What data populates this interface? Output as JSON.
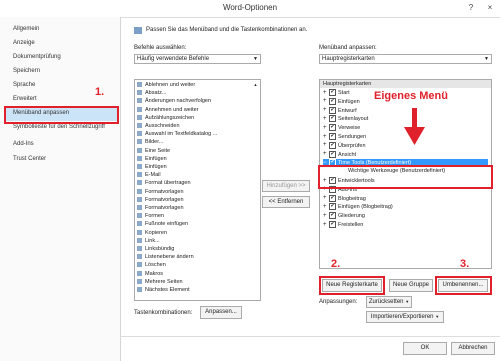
{
  "window": {
    "title": "Word-Optionen",
    "help": "?",
    "close": "×"
  },
  "sidebar": {
    "items": [
      "Allgemein",
      "Anzeige",
      "Dokumentprüfung",
      "Speichern",
      "Sprache",
      "Erweitert",
      "Menüband anpassen",
      "Symbolleiste für den Schnellzugriff",
      "Add-Ins",
      "Trust Center"
    ]
  },
  "header": {
    "text": "Passen Sie das Menüband und die Tastenkombinationen an."
  },
  "left_panel": {
    "label": "Befehle auswählen:",
    "select_value": "Häufig verwendete Befehle",
    "items": [
      "Ablehnen und weiter",
      "Absatz...",
      "Änderungen nachverfolgen",
      "Annehmen und weiter",
      "Aufzählungszeichen",
      "Ausschneiden",
      "Auswahl im Textfeldkatalog ...",
      "Bilder...",
      "Eine Seite",
      "Einfügen",
      "Einfügen",
      "E-Mail",
      "Format übertragen",
      "Formatvorlagen",
      "Formatvorlagen",
      "Formatvorlagen",
      "Formen",
      "Fußnote einfügen",
      "Kopieren",
      "Link...",
      "Linksbündig",
      "Listenebene ändern",
      "Löschen",
      "Makros",
      "Mehrere Seiten",
      "Nächstes Element"
    ]
  },
  "middle": {
    "add": "Hinzufügen >>",
    "remove": "<< Entfernen"
  },
  "right_panel": {
    "label": "Menüband anpassen:",
    "select_value": "Hauptregisterkarten",
    "tree_header": "Hauptregisterkarten",
    "items": [
      "Start",
      "Einfügen",
      "Entwurf",
      "Seitenlayout",
      "Verweise",
      "Sendungen",
      "Überprüfen",
      "Ansicht",
      "Time Tools (Benutzerdefiniert)",
      "Wichtige Werkzeuge (Benutzerdefiniert)",
      "Entwicklertools",
      "Add-Ins",
      "Blogbeitrag",
      "Einfügen (Blogbeitrag)",
      "Gliederung",
      "Freistellen"
    ]
  },
  "buttons": {
    "new_tab": "Neue Registerkarte",
    "new_group": "Neue Gruppe",
    "rename": "Umbenennen...",
    "reset": "Zurücksetten",
    "import_export": "Importieren/Exportieren",
    "ok": "OK",
    "cancel": "Abbrechen",
    "customize": "Anpassen..."
  },
  "labels": {
    "customizations": "Anpassungen:",
    "shortcuts": "Tastenkombinationen:"
  },
  "annotations": {
    "step1": "1.",
    "step2": "2.",
    "step3": "3.",
    "own_menu": "Eigenes Menü"
  },
  "colors": {
    "annotation": "#e0202a",
    "selection": "#cce4f7",
    "highlight": "#3399ff"
  }
}
